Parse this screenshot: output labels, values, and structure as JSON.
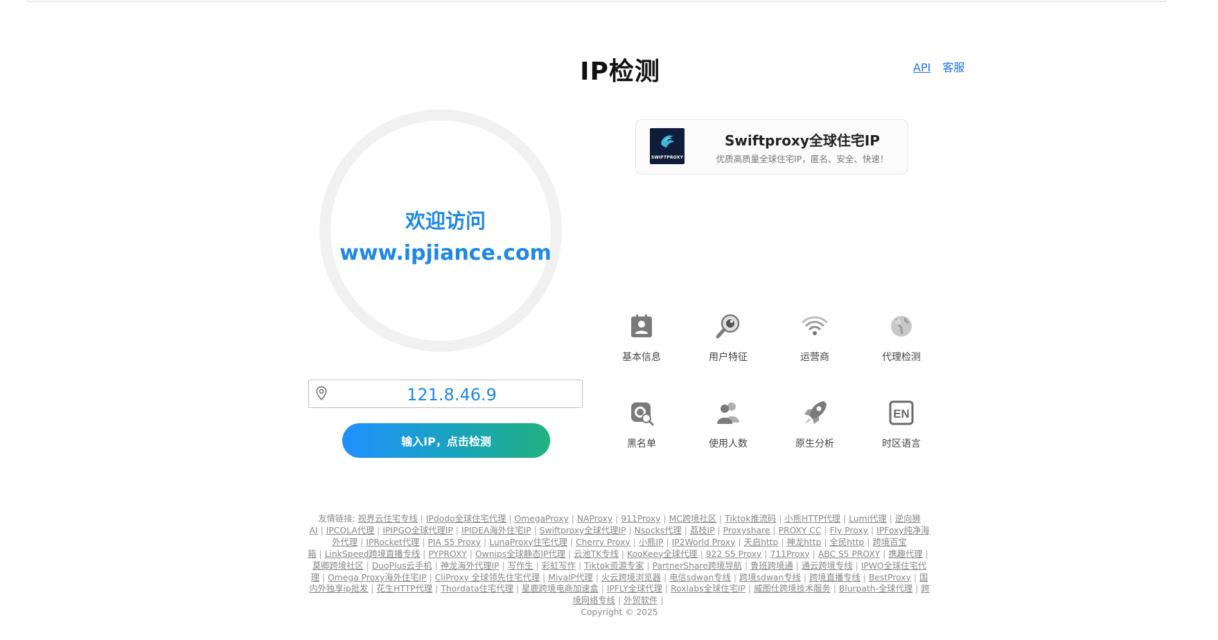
{
  "header": {
    "title": "IP检测",
    "links": [
      {
        "label": "API"
      },
      {
        "label": "客服"
      }
    ]
  },
  "welcome": {
    "line1": "欢迎访问",
    "line2": "www.ipjiance.com"
  },
  "ip_input": {
    "value": "121.8.46.9",
    "icon": "map-pin-icon"
  },
  "detect_button": {
    "label": "输入IP，点击检测"
  },
  "promo": {
    "logo_text": "SWIFTPROXY",
    "title": "Swiftproxy全球住宅IP",
    "subtitle": "优质高质量全球住宅IP，匿名、安全、快速！"
  },
  "features": [
    {
      "label": "基本信息",
      "icon": "id-card-icon"
    },
    {
      "label": "用户特征",
      "icon": "magnifier-icon"
    },
    {
      "label": "运营商",
      "icon": "wifi-icon"
    },
    {
      "label": "代理检测",
      "icon": "globe-icon"
    },
    {
      "label": "黑名单",
      "icon": "blacklist-search-icon"
    },
    {
      "label": "使用人数",
      "icon": "users-icon"
    },
    {
      "label": "原生分析",
      "icon": "rocket-icon"
    },
    {
      "label": "时区语言",
      "icon": "en-language-icon"
    }
  ],
  "colors": {
    "accent": "#1e88e5",
    "button_gradient_start": "#1e90ff",
    "button_gradient_end": "#20b27e",
    "icon_gray": "#7a7a7a"
  },
  "footer": {
    "prefix": "友情链接:",
    "links": [
      "视界云住宅专线",
      "IPdodo全球住宅代理",
      "OmegaProxy",
      "NAProxy",
      "911Proxy",
      "MC跨境社区",
      "Tiktok推流码",
      "小熊HTTP代理",
      "Lumi代理",
      "逆向狮AI",
      "IPCOLA代理",
      "IPIPGO全球代理IP",
      "IPIDEA海外住宅IP",
      "Swiftproxy全球代理IP",
      "Nsocks代理",
      "荔枝IP",
      "Proxyshare",
      "PROXY CC",
      "Fly Proxy",
      "IPFoxy纯净海外代理",
      "IPRocket代理",
      "PIA S5 Proxy",
      "LunaProxy住宅代理",
      "Cherry Proxy",
      "小熊IP",
      "IP2World Proxy",
      "天启http",
      "神龙http",
      "全民http",
      "跨境百宝箱",
      "LinkSpeed跨境直播专线",
      "PYPROXY",
      "Ownips全球静态IP代理",
      "云池TK专线",
      "KooKeey全球代理",
      "922 S5 Proxy",
      "711Proxy",
      "ABC S5 PROXY",
      "携趣代理",
      "莫卿跨境社区",
      "DuoPlus云手机",
      "神龙海外代理IP",
      "写作生",
      "彩虹写作",
      "Tiktok资源专家",
      "PartnerShare跨境导航",
      "鲁班跨境通",
      "通云跨境专线",
      "IPWO全球住宅代理",
      "Omega Proxy海外住宅IP",
      "CliProxy 全球领先住宅代理",
      "MiyaIP代理",
      "火云跨境浏览器",
      "电信sdwan专线",
      "跨境sdwan专线",
      "跨境直播专线",
      "BestProxy",
      "国内外独享ip批发",
      "花生HTTP代理",
      "Thordata住宅代理",
      "星鹿跨境电商加速盒",
      "IPFLY全球代理",
      "Roxlabs全球住宅IP",
      "威图仕跨境技术服务",
      "Blurpath-全球代理",
      "跨境网络专线",
      "外贸软件"
    ],
    "copyright": "Copyright © 2025"
  }
}
